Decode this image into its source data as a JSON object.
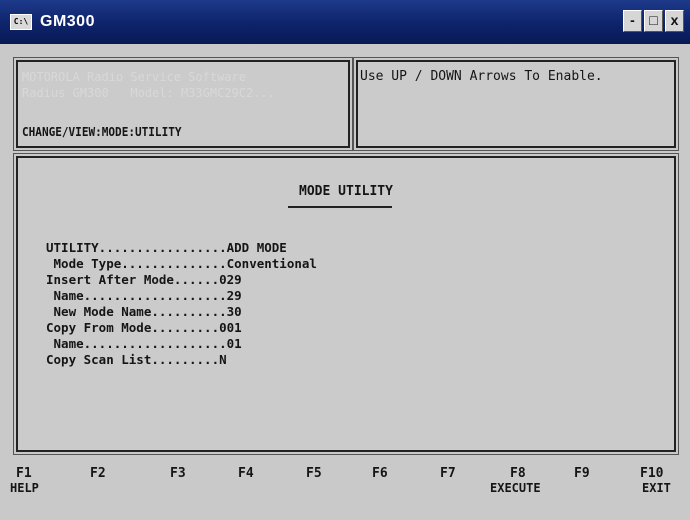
{
  "window": {
    "title": "GM300",
    "icon_text": "C:\\",
    "controls": {
      "minimize": "-",
      "maximize": "□",
      "close": "x"
    }
  },
  "info_panel": {
    "line1": "MOTOROLA Radio Service Software",
    "line2": "Radius GM300   Model: M33GMC29C2...",
    "path": "CHANGE/VIEW:MODE:UTILITY"
  },
  "prompt_panel": {
    "message": "Use UP / DOWN Arrows To Enable."
  },
  "main": {
    "title": "MODE UTILITY",
    "fields": [
      {
        "text": "UTILITY.................ADD MODE"
      },
      {
        "text": " Mode Type..............Conventional"
      },
      {
        "text": "Insert After Mode......029"
      },
      {
        "text": " Name...................29"
      },
      {
        "text": " New Mode Name..........30"
      },
      {
        "text": "Copy From Mode.........001"
      },
      {
        "text": " Name...................01"
      },
      {
        "text": "Copy Scan List.........N"
      }
    ]
  },
  "function_keys": [
    {
      "key": "F1",
      "label": "HELP"
    },
    {
      "key": "F2",
      "label": ""
    },
    {
      "key": "F3",
      "label": ""
    },
    {
      "key": "F4",
      "label": ""
    },
    {
      "key": "F5",
      "label": ""
    },
    {
      "key": "F6",
      "label": ""
    },
    {
      "key": "F7",
      "label": ""
    },
    {
      "key": "F8",
      "label": "EXECUTE"
    },
    {
      "key": "F9",
      "label": ""
    },
    {
      "key": "F10",
      "label": "EXIT"
    }
  ]
}
